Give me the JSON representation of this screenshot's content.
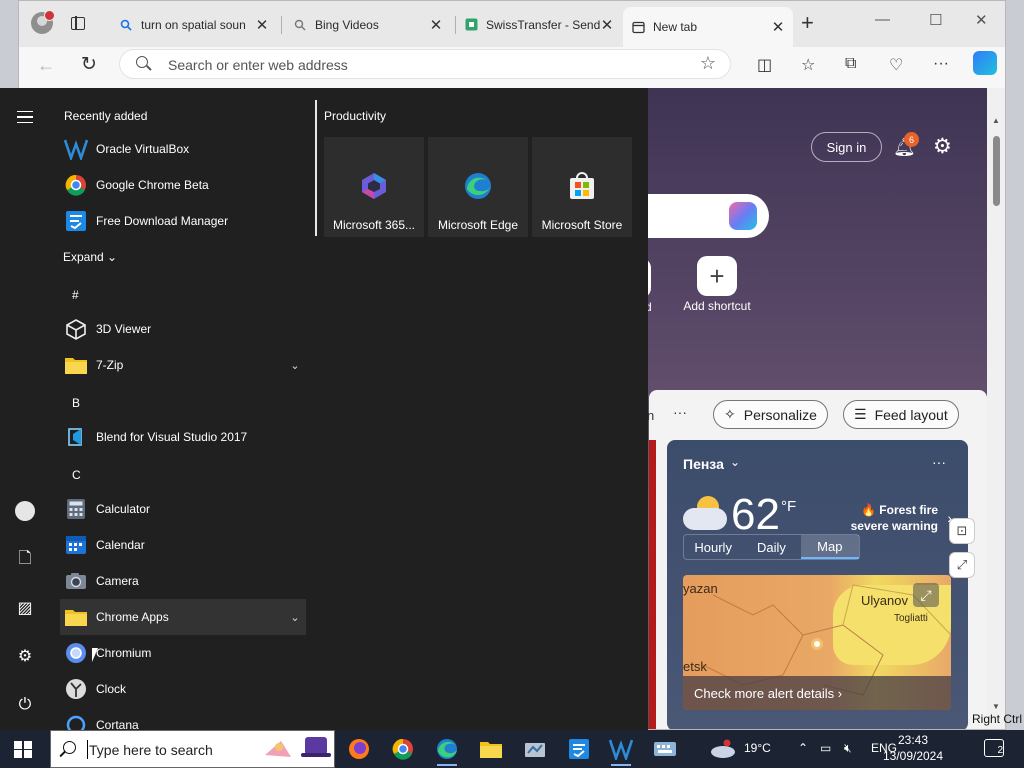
{
  "browser": {
    "tabs": [
      {
        "title": "turn on spatial soun",
        "favicon": "search-icon",
        "active": false
      },
      {
        "title": "Bing Videos",
        "favicon": "search-icon",
        "active": false
      },
      {
        "title": "SwissTransfer - Send",
        "favicon": "swisstransfer-icon",
        "active": false
      },
      {
        "title": "New tab",
        "favicon": "newtab-page-icon",
        "active": true
      }
    ],
    "address_placeholder": "Search or enter web address"
  },
  "ntp": {
    "signin_label": "Sign in",
    "notification_count": "6",
    "partial_shortcut_label": "d",
    "add_shortcut_label": "Add shortcut",
    "feed_partial_tab": "n",
    "feed_more": "···",
    "personalize_label": "Personalize",
    "feed_layout_label": "Feed layout",
    "weather": {
      "city": "Пенза",
      "temp": "62",
      "unit": "°F",
      "alert_line1": "🔥 Forest fire",
      "alert_line2": "severe warning",
      "tabs": [
        "Hourly",
        "Daily",
        "Map"
      ],
      "selected_tab": "Map",
      "map_labels": [
        "yazan",
        "Ulyanov",
        "Togliatti",
        "etsk"
      ],
      "map_cta": "Check more alert details"
    },
    "right_ctrl_text": "Right Ctrl"
  },
  "startmenu": {
    "recently_added_heading": "Recently added",
    "recently_added": [
      {
        "label": "Oracle VirtualBox",
        "icon": "virtualbox-icon"
      },
      {
        "label": "Google Chrome Beta",
        "icon": "chrome-beta-icon"
      },
      {
        "label": "Free Download Manager",
        "icon": "fdm-icon"
      }
    ],
    "expand_label": "Expand",
    "letters": [
      "#",
      "B",
      "C"
    ],
    "apps": [
      {
        "label": "3D Viewer",
        "icon": "3d-viewer-icon",
        "has_chevron": false
      },
      {
        "label": "7-Zip",
        "icon": "folder-icon",
        "has_chevron": true
      },
      {
        "label": "Blend for Visual Studio 2017",
        "icon": "blend-icon",
        "has_chevron": false
      },
      {
        "label": "Calculator",
        "icon": "calculator-icon",
        "has_chevron": false
      },
      {
        "label": "Calendar",
        "icon": "calendar-icon",
        "has_chevron": false
      },
      {
        "label": "Camera",
        "icon": "camera-icon",
        "has_chevron": false
      },
      {
        "label": "Chrome Apps",
        "icon": "folder-icon",
        "has_chevron": true
      },
      {
        "label": "Chromium",
        "icon": "chromium-icon",
        "has_chevron": false
      },
      {
        "label": "Clock",
        "icon": "clock-icon",
        "has_chevron": false
      },
      {
        "label": "Cortana",
        "icon": "cortana-icon",
        "has_chevron": false
      }
    ],
    "productivity_heading": "Productivity",
    "tiles": [
      {
        "label": "Microsoft 365...",
        "icon": "microsoft-365-icon"
      },
      {
        "label": "Microsoft Edge",
        "icon": "edge-icon"
      },
      {
        "label": "Microsoft Store",
        "icon": "store-icon"
      }
    ]
  },
  "taskbar": {
    "search_placeholder": "Type here to search",
    "weather_temp": "19°C",
    "language": "ENG",
    "time": "23:43",
    "date": "13/09/2024",
    "notification_count": "2"
  },
  "colors": {
    "start_bg": "#202020",
    "taskbar_bg": "#1c2433",
    "accent_blue": "#6bb8ff",
    "alert_orange": "#e8622a"
  }
}
